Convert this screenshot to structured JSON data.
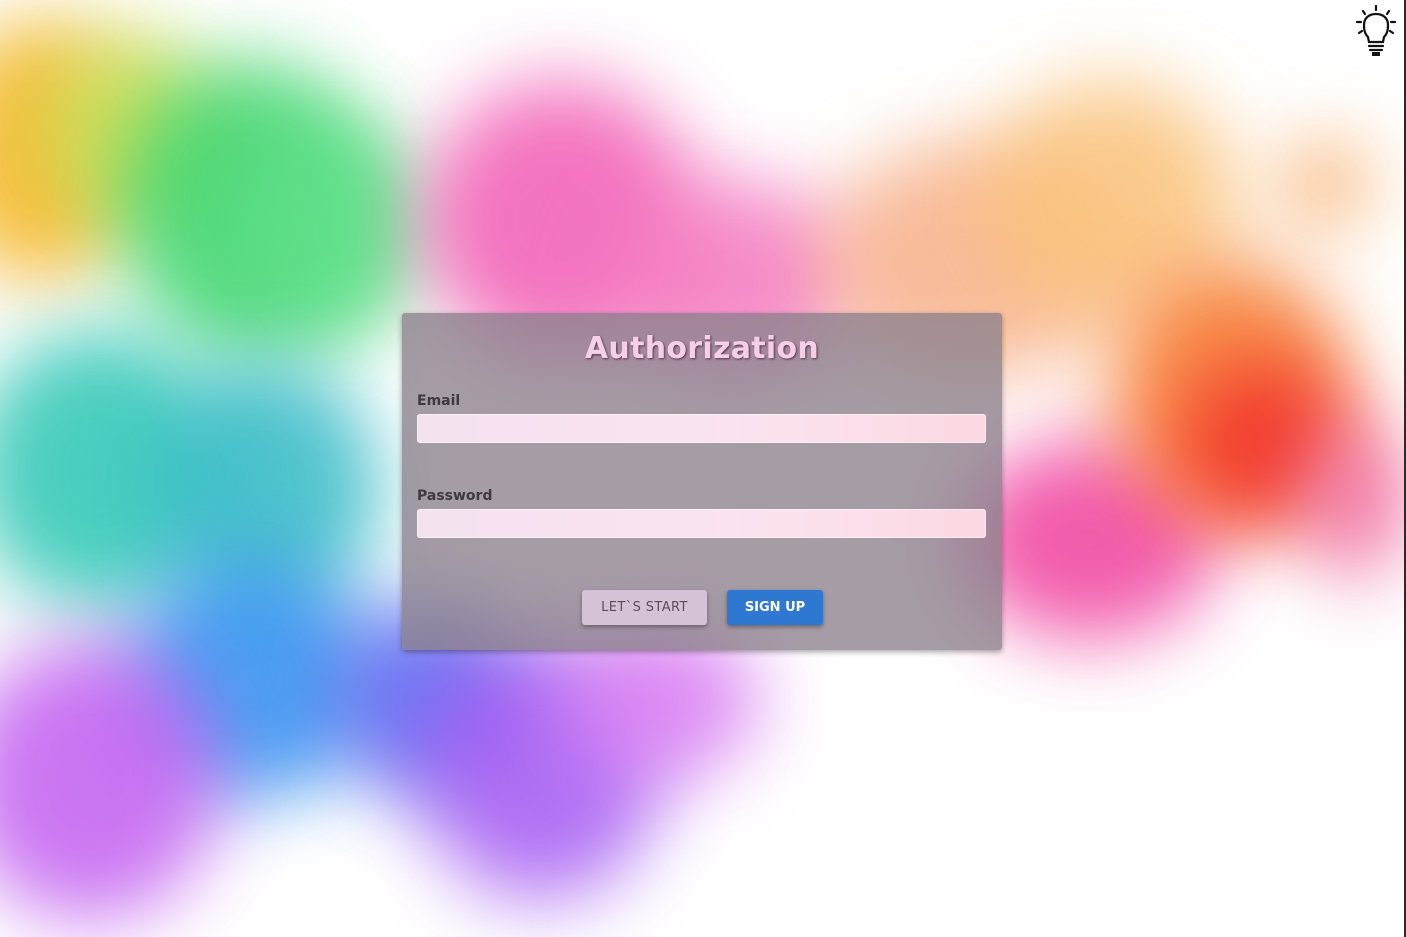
{
  "page": {
    "title": "Authorization"
  },
  "form": {
    "email_label": "Email",
    "email_value": "",
    "password_label": "Password",
    "password_value": "",
    "start_button": "LET`S START",
    "signup_button": "SIGN UP"
  },
  "icons": {
    "top_right": "lightbulb-icon"
  },
  "colors": {
    "title": "#f6cfe6",
    "signup_button": "#2f78d2",
    "start_button": "#d6c2d6",
    "panel": "#8c808c"
  }
}
